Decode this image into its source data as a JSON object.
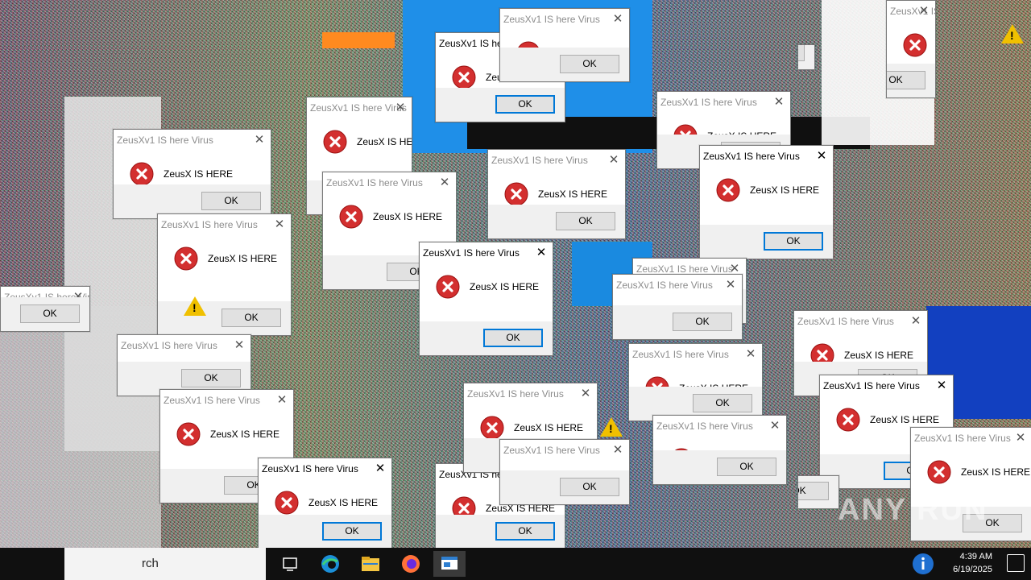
{
  "dialog": {
    "title": "ZeusXv1 IS here Virus",
    "message": "ZeusX IS HERE",
    "ok_label": "OK",
    "close_glyph": "✕",
    "icon": "error-icon"
  },
  "taskbar": {
    "search_placeholder": "Type here to search",
    "search_visible_text": "rch",
    "apps": [
      "task-view-icon",
      "edge-icon",
      "file-explorer-icon",
      "firefox-icon",
      "dialog-app-icon"
    ],
    "time": "4:39 AM",
    "date": "6/19/2025"
  },
  "watermark": "ANY RUN",
  "colors": {
    "error_red": "#d32f2f",
    "button_bg": "#e1e1e1",
    "focus_blue": "#0078d7",
    "warning_yellow": "#f0c000",
    "taskbar": "#101010"
  }
}
